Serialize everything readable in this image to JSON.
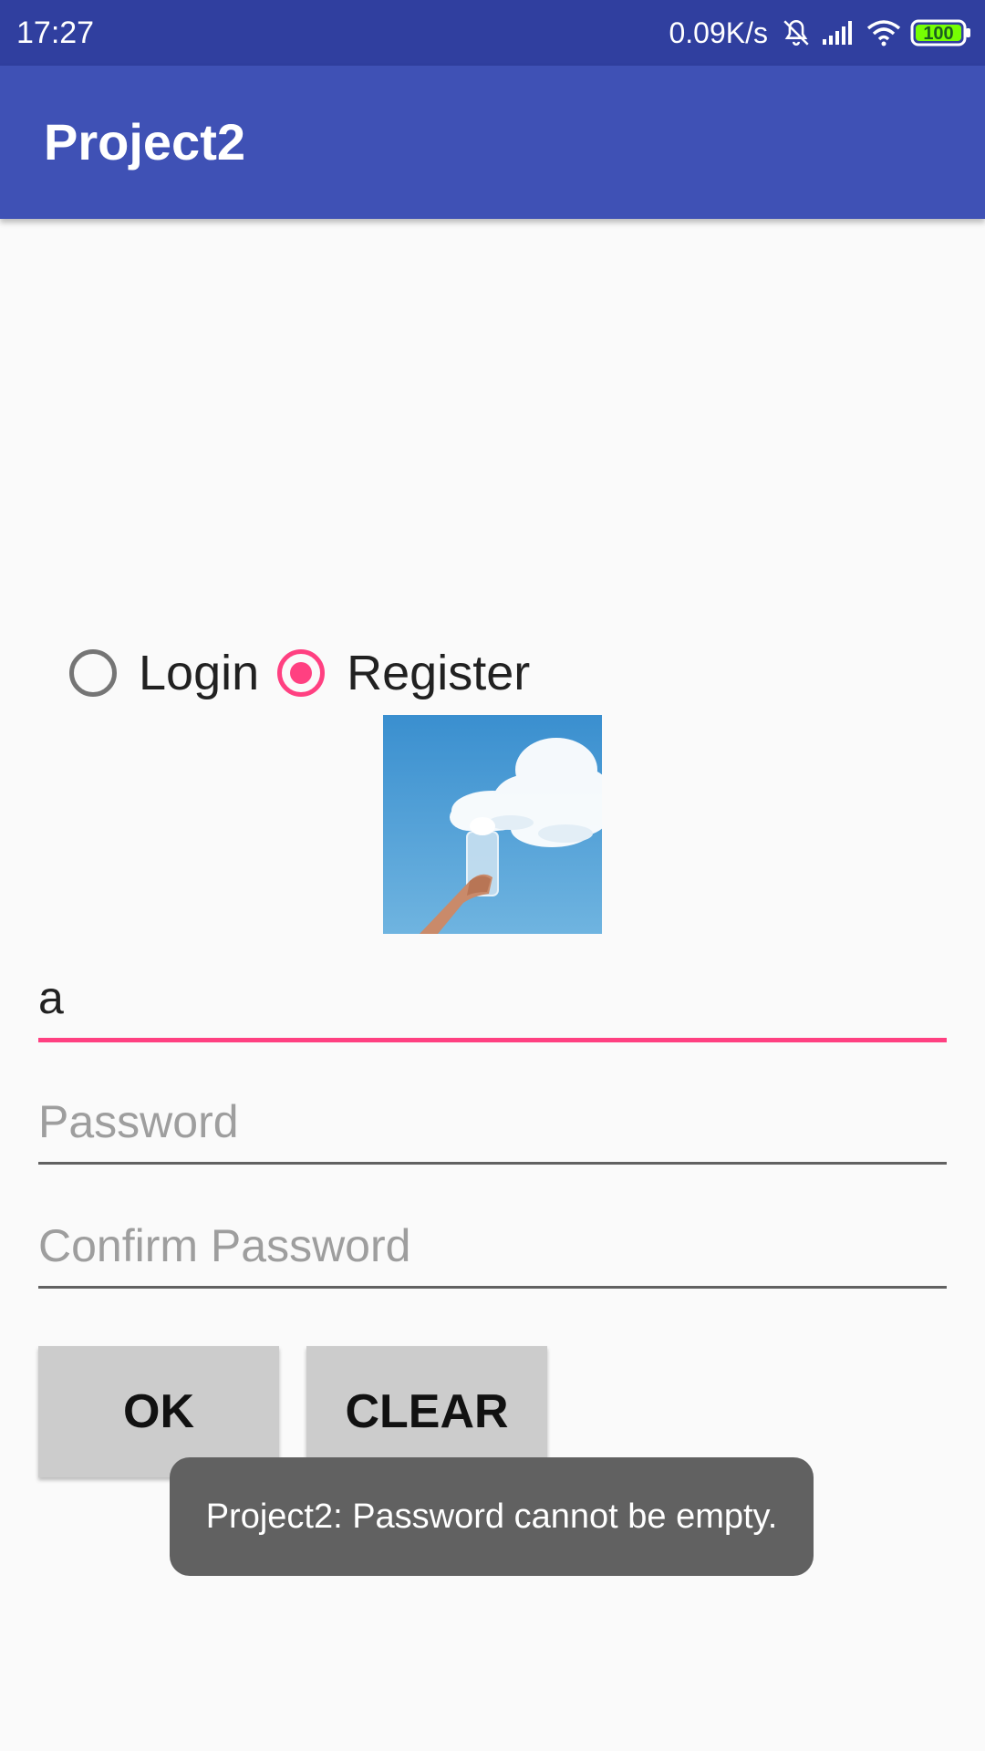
{
  "status_bar": {
    "time": "17:27",
    "network_speed": "0.09K/s",
    "battery_level": "100",
    "icons": [
      "bell-off-icon",
      "signal-icon",
      "wifi-icon",
      "battery-icon"
    ]
  },
  "app_bar": {
    "title": "Project2"
  },
  "mode_selector": {
    "options": [
      {
        "label": "Login",
        "selected": false
      },
      {
        "label": "Register",
        "selected": true
      }
    ]
  },
  "form": {
    "username": {
      "value": "a",
      "placeholder": ""
    },
    "password": {
      "value": "",
      "placeholder": "Password"
    },
    "confirm_password": {
      "value": "",
      "placeholder": "Confirm Password"
    }
  },
  "buttons": {
    "ok_label": "OK",
    "clear_label": "CLEAR"
  },
  "toast": {
    "message": "Project2: Password cannot be empty."
  },
  "colors": {
    "status_bar": "#303f9f",
    "app_bar": "#3f51b5",
    "accent": "#ff4081",
    "button": "#cccccc",
    "toast": "#616161"
  }
}
